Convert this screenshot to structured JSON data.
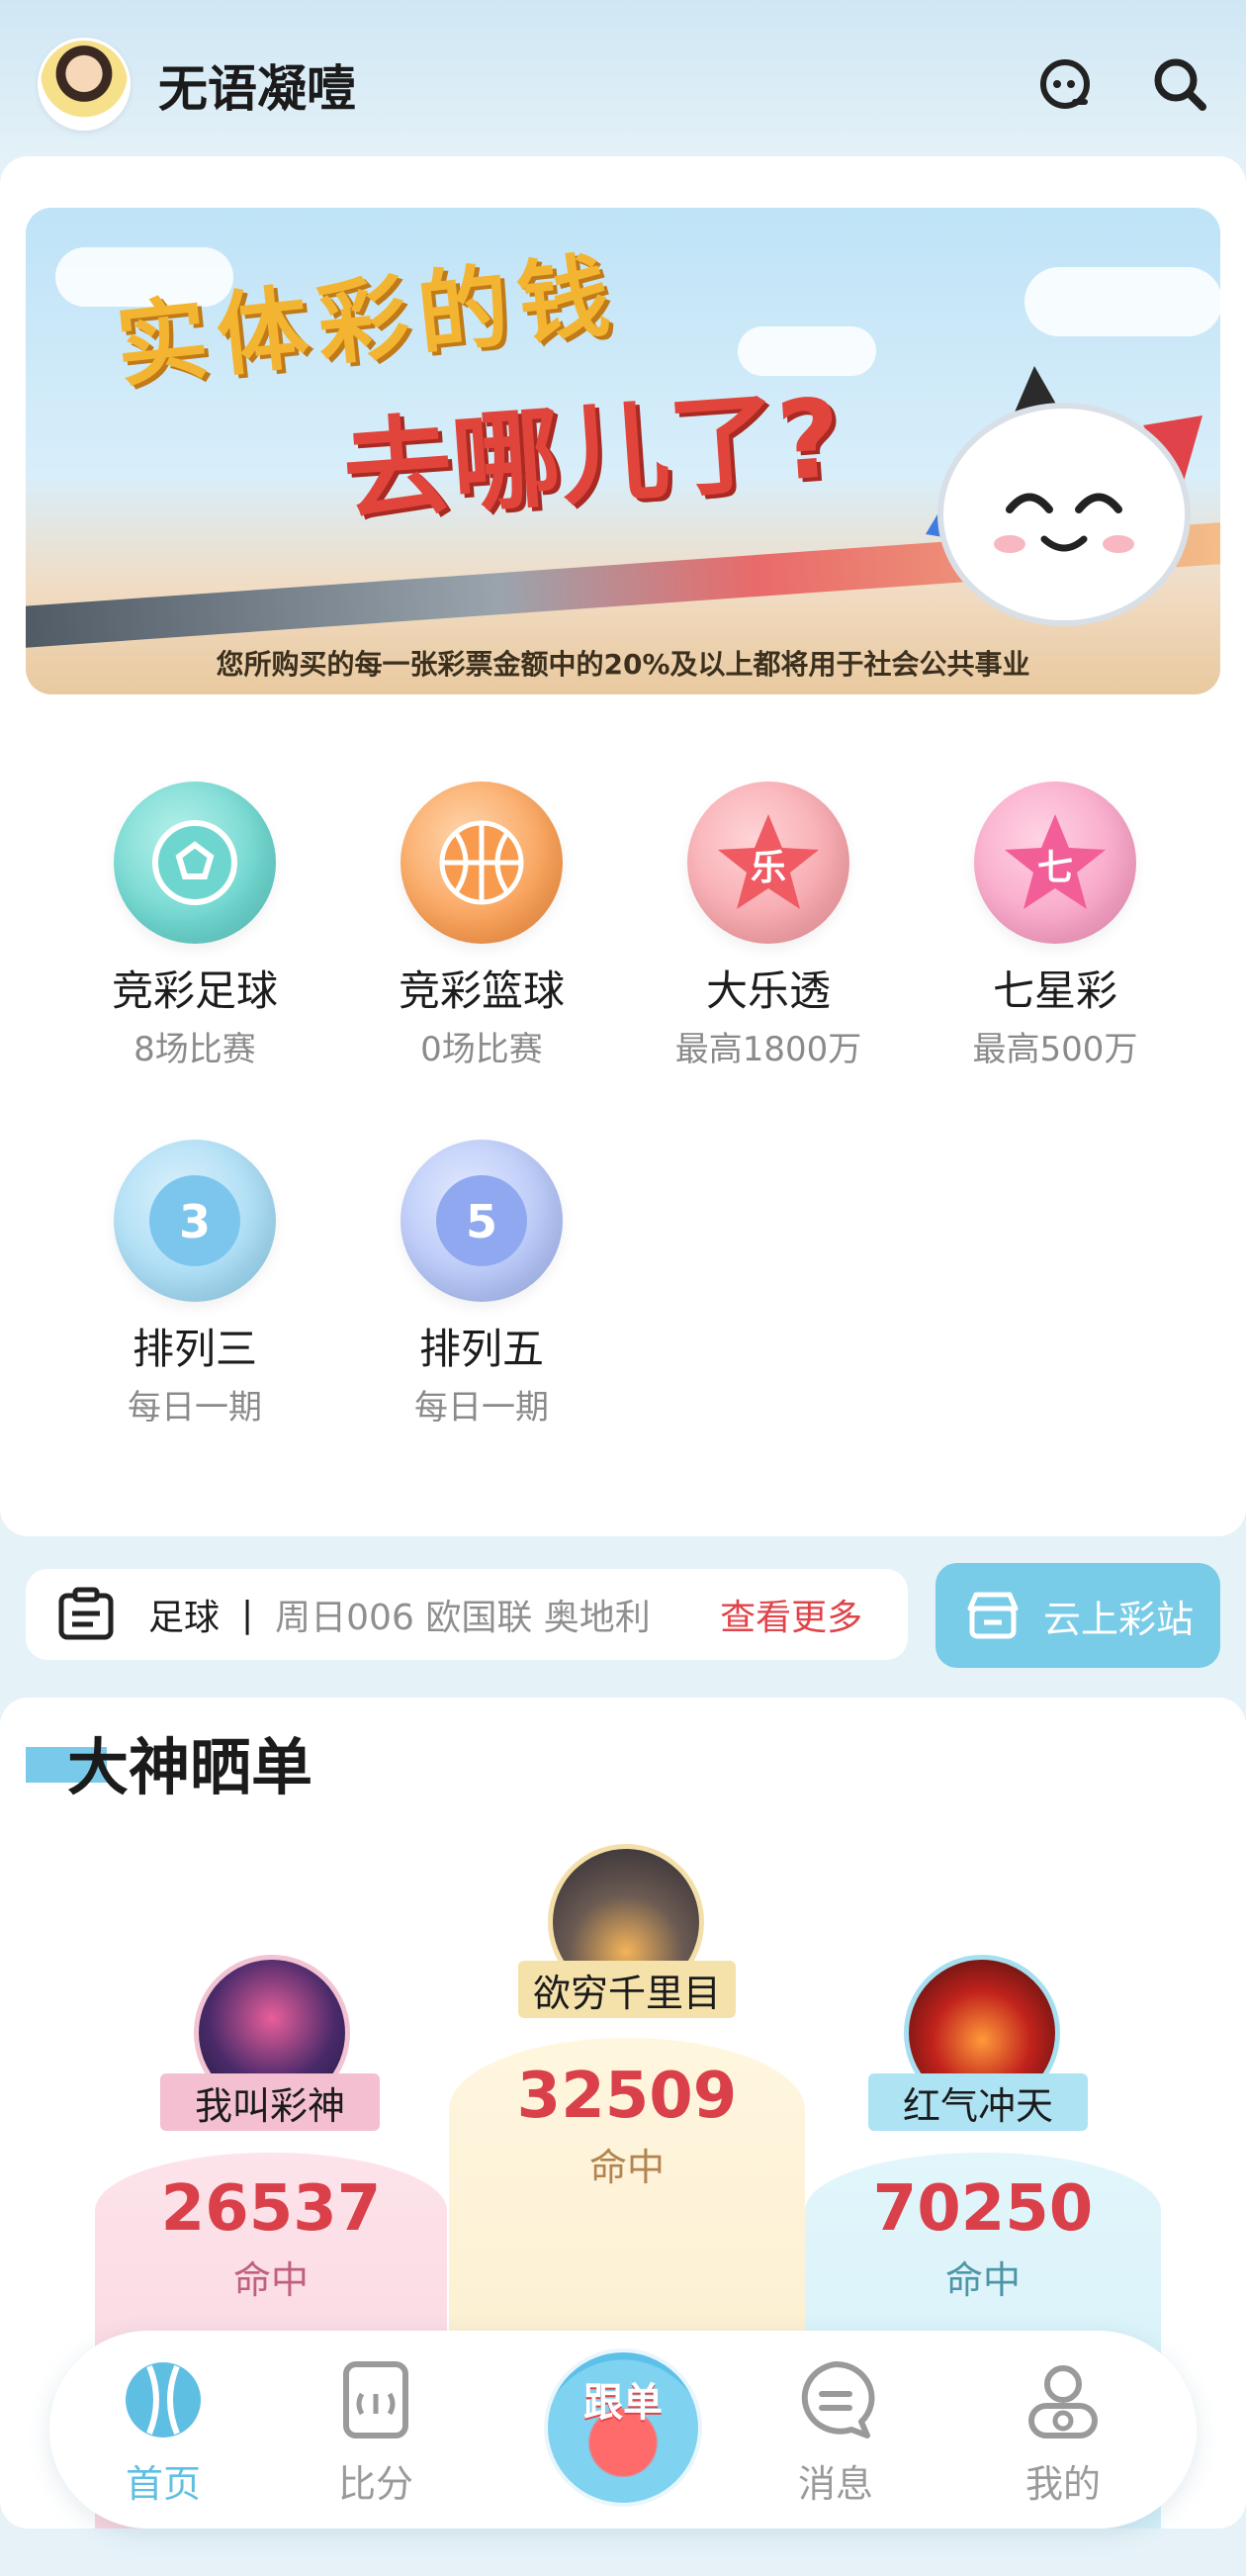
{
  "header": {
    "app_title": "无语凝噎",
    "service_icon": "headset-bot-icon",
    "search_icon": "search-icon"
  },
  "banner": {
    "headline_1": "实体彩的钱",
    "headline_2": "去哪儿了?",
    "caption": "您所购买的每一张彩票金额中的20%及以上都将用于社会公共事业"
  },
  "games": [
    {
      "name": "竞彩足球",
      "sub": "8场比赛",
      "icon": "soccer-ball-icon",
      "color": "#6fd6cf"
    },
    {
      "name": "竞彩篮球",
      "sub": "0场比赛",
      "icon": "basketball-icon",
      "color": "#f9a25a"
    },
    {
      "name": "大乐透",
      "sub": "最高1800万",
      "icon": "star-le-icon",
      "color": "#f06a72"
    },
    {
      "name": "七星彩",
      "sub": "最高500万",
      "icon": "star-seven-icon",
      "color": "#f46b9f"
    },
    {
      "name": "排列三",
      "sub": "每日一期",
      "icon": "ball-3-icon",
      "color": "#7cc6ee"
    },
    {
      "name": "排列五",
      "sub": "每日一期",
      "icon": "ball-5-icon",
      "color": "#8fa8f0"
    }
  ],
  "ticker": {
    "sport": "足球",
    "separator": "|",
    "item": "周日006 欧国联 奥地利",
    "more": "查看更多"
  },
  "cloud_station": {
    "label": "云上彩站"
  },
  "leaderboard": {
    "title": "大神晒单",
    "entries": [
      {
        "rank": 2,
        "name": "我叫彩神",
        "score": "26537",
        "hit": "命中",
        "color": "#e48fae"
      },
      {
        "rank": 1,
        "name": "欲穷千里目",
        "score": "32509",
        "hit": "命中",
        "color": "#c79a5f"
      },
      {
        "rank": 3,
        "name": "红气冲天",
        "score": "70250",
        "hit": "命中",
        "color": "#5fa7b8"
      }
    ]
  },
  "bottom_nav": [
    {
      "label": "首页",
      "icon": "home-ball-icon",
      "active": true
    },
    {
      "label": "比分",
      "icon": "score-card-icon",
      "active": false
    },
    {
      "label": "跟单",
      "icon": "follow-mascot-icon",
      "active": false
    },
    {
      "label": "消息",
      "icon": "message-bubble-icon",
      "active": false
    },
    {
      "label": "我的",
      "icon": "profile-icon",
      "active": false
    }
  ]
}
